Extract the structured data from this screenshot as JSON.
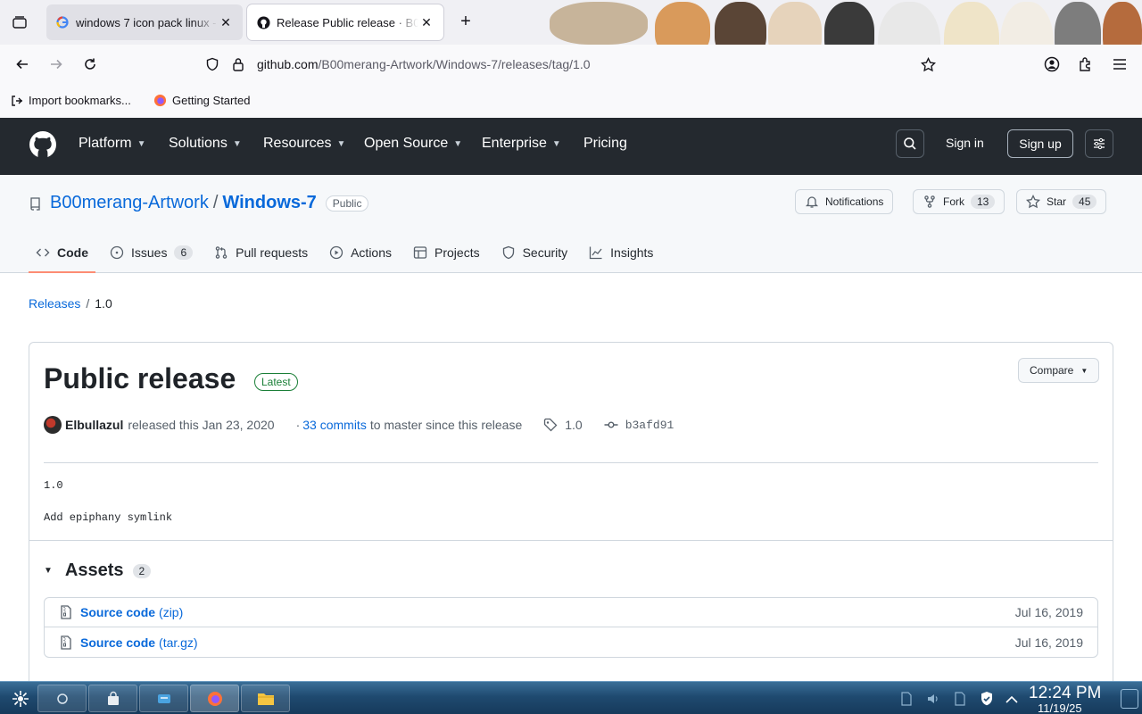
{
  "browser": {
    "tabs": [
      {
        "title": "windows 7 icon pack linux - Google Search",
        "active": false
      },
      {
        "title": "Release Public release · B00merang-Artwork/Windows-7",
        "active": true
      }
    ],
    "url": {
      "domain": "github.com",
      "path": "/B00merang-Artwork/Windows-7/releases/tag/1.0"
    },
    "bookmarks": [
      {
        "label": "Import bookmarks..."
      },
      {
        "label": "Getting Started"
      }
    ]
  },
  "github": {
    "menu": [
      {
        "label": "Platform",
        "dropdown": true
      },
      {
        "label": "Solutions",
        "dropdown": true
      },
      {
        "label": "Resources",
        "dropdown": true
      },
      {
        "label": "Open Source",
        "dropdown": true
      },
      {
        "label": "Enterprise",
        "dropdown": true
      },
      {
        "label": "Pricing",
        "dropdown": false
      }
    ],
    "sign_in": "Sign in",
    "sign_up": "Sign up"
  },
  "repo": {
    "owner": "B00merang-Artwork",
    "separator": "/",
    "name": "Windows-7",
    "visibility": "Public",
    "notifications_label": "Notifications",
    "fork_label": "Fork",
    "fork_count": "13",
    "star_label": "Star",
    "star_count": "45",
    "nav": [
      {
        "label": "Code",
        "icon": "code-icon",
        "selected": true
      },
      {
        "label": "Issues",
        "icon": "issue-icon",
        "count": "6"
      },
      {
        "label": "Pull requests",
        "icon": "pull-request-icon"
      },
      {
        "label": "Actions",
        "icon": "play-icon"
      },
      {
        "label": "Projects",
        "icon": "table-icon"
      },
      {
        "label": "Security",
        "icon": "shield-icon"
      },
      {
        "label": "Insights",
        "icon": "graph-icon"
      }
    ]
  },
  "breadcrumb": {
    "releases": "Releases",
    "separator": "/",
    "current": "1.0"
  },
  "release": {
    "title": "Public release",
    "badge": "Latest",
    "compare": "Compare",
    "author": "Elbullazul",
    "released_text": "released this Jan 23, 2020",
    "commits_prefix": "·",
    "commits_link": "33 commits",
    "commits_suffix": "to master since this release",
    "tag": "1.0",
    "commit": "b3afd91",
    "body_line1": "1.0",
    "body_line2": "Add epiphany symlink",
    "assets_label": "Assets",
    "assets_count": "2",
    "assets": [
      {
        "name": "Source code",
        "ext": "(zip)",
        "date": "Jul 16, 2019"
      },
      {
        "name": "Source code",
        "ext": "(tar.gz)",
        "date": "Jul 16, 2019"
      }
    ]
  },
  "taskbar": {
    "time": "12:24 PM",
    "date": "11/19/25"
  },
  "colors": {
    "link": "#0969da",
    "github_header": "#24292f",
    "latest_green": "#1a7f37",
    "selected_tab_underline": "#fd8c73",
    "taskbar": "#1f4a70"
  }
}
